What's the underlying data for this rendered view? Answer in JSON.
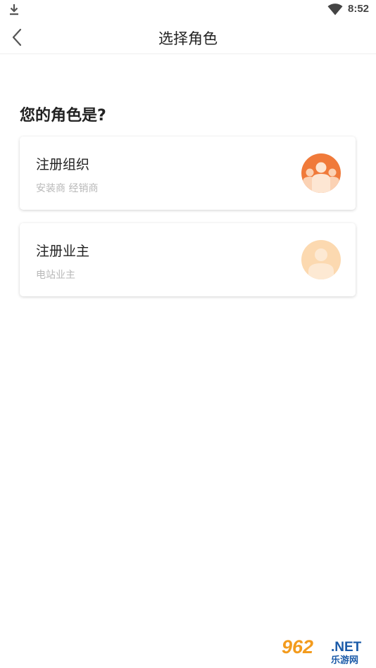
{
  "status_bar": {
    "time": "8:52",
    "download_icon": "download-icon",
    "wifi_icon": "wifi-icon"
  },
  "nav": {
    "back_icon": "chevron-left-icon",
    "title": "选择角色"
  },
  "prompt": "您的角色是?",
  "roles": [
    {
      "title": "注册组织",
      "subtitle": "安装商 经销商",
      "icon": "group-avatar-icon",
      "icon_color": "#f07a3a"
    },
    {
      "title": "注册业主",
      "subtitle": "电站业主",
      "icon": "user-avatar-icon",
      "icon_color": "#fcd9b0"
    }
  ],
  "watermark": {
    "number": "962",
    "domain": ".NET",
    "site_name": "乐游网"
  }
}
